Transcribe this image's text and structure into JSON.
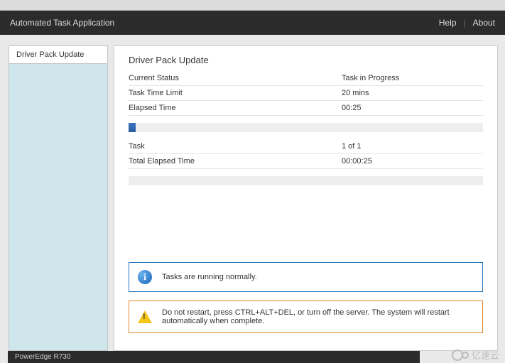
{
  "header": {
    "title": "Automated Task Application",
    "help": "Help",
    "about": "About"
  },
  "sidebar": {
    "items": [
      "Driver Pack Update"
    ]
  },
  "main": {
    "title": "Driver Pack Update",
    "status_rows": [
      {
        "label": "Current Status",
        "value": "Task in Progress"
      },
      {
        "label": "Task Time Limit",
        "value": "20 mins"
      },
      {
        "label": "Elapsed Time",
        "value": "00:25"
      }
    ],
    "progress1_pct": 2,
    "summary_rows": [
      {
        "label": "Task",
        "value": "1 of 1"
      },
      {
        "label": "Total Elapsed Time",
        "value": "00:00:25"
      }
    ],
    "progress2_pct": 0,
    "info_msg": "Tasks are running normally.",
    "warn_msg": "Do not restart, press CTRL+ALT+DEL, or turn off the server.  The system will restart automatically when complete."
  },
  "footer": {
    "model": "PowerEdge R730"
  },
  "watermark": "亿速云"
}
